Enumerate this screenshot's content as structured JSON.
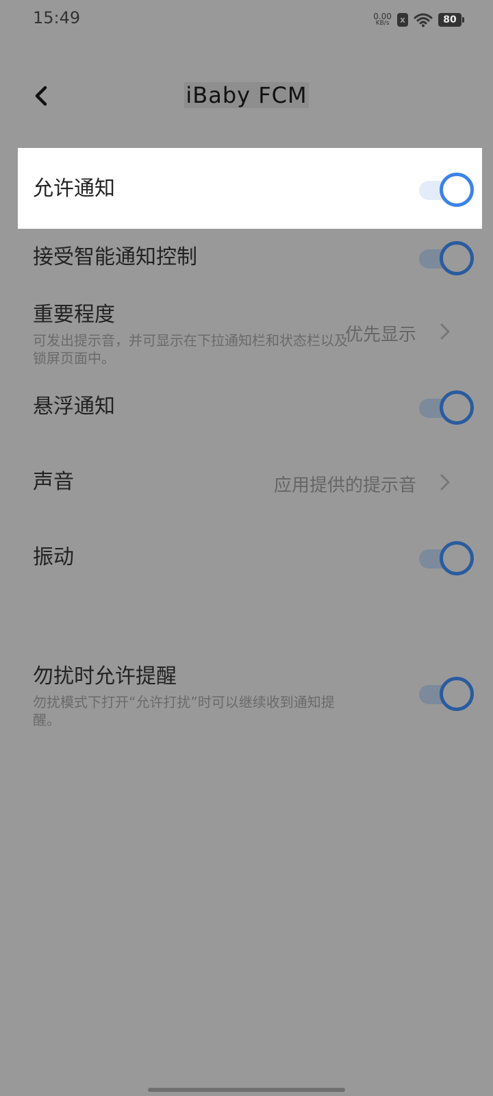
{
  "status_bar": {
    "time": "15:49",
    "net_speed_value": "0.00",
    "net_speed_unit": "KB/s",
    "sim_icon": "x",
    "battery_level": "80"
  },
  "header": {
    "title": "iBaby FCM",
    "back_icon": "chevron-left-icon"
  },
  "settings": {
    "allow_notifications": {
      "label": "允许通知",
      "enabled": true
    },
    "smart_notification_control": {
      "label": "接受智能通知控制",
      "enabled": true
    },
    "importance": {
      "label": "重要程度",
      "description": "可发出提示音，并可显示在下拉通知栏和状态栏以及锁屏页面中。",
      "value": "优先显示"
    },
    "floating_notifications": {
      "label": "悬浮通知",
      "enabled": true
    },
    "sound": {
      "label": "声音",
      "value": "应用提供的提示音"
    },
    "vibration": {
      "label": "振动",
      "enabled": true
    },
    "dnd_allow": {
      "label": "勿扰时允许提醒",
      "description": "勿扰模式下打开“允许打扰”时可以继续收到通知提醒。",
      "enabled": true
    }
  },
  "colors": {
    "overlay": "#999999",
    "accent": "#3b83e8"
  }
}
